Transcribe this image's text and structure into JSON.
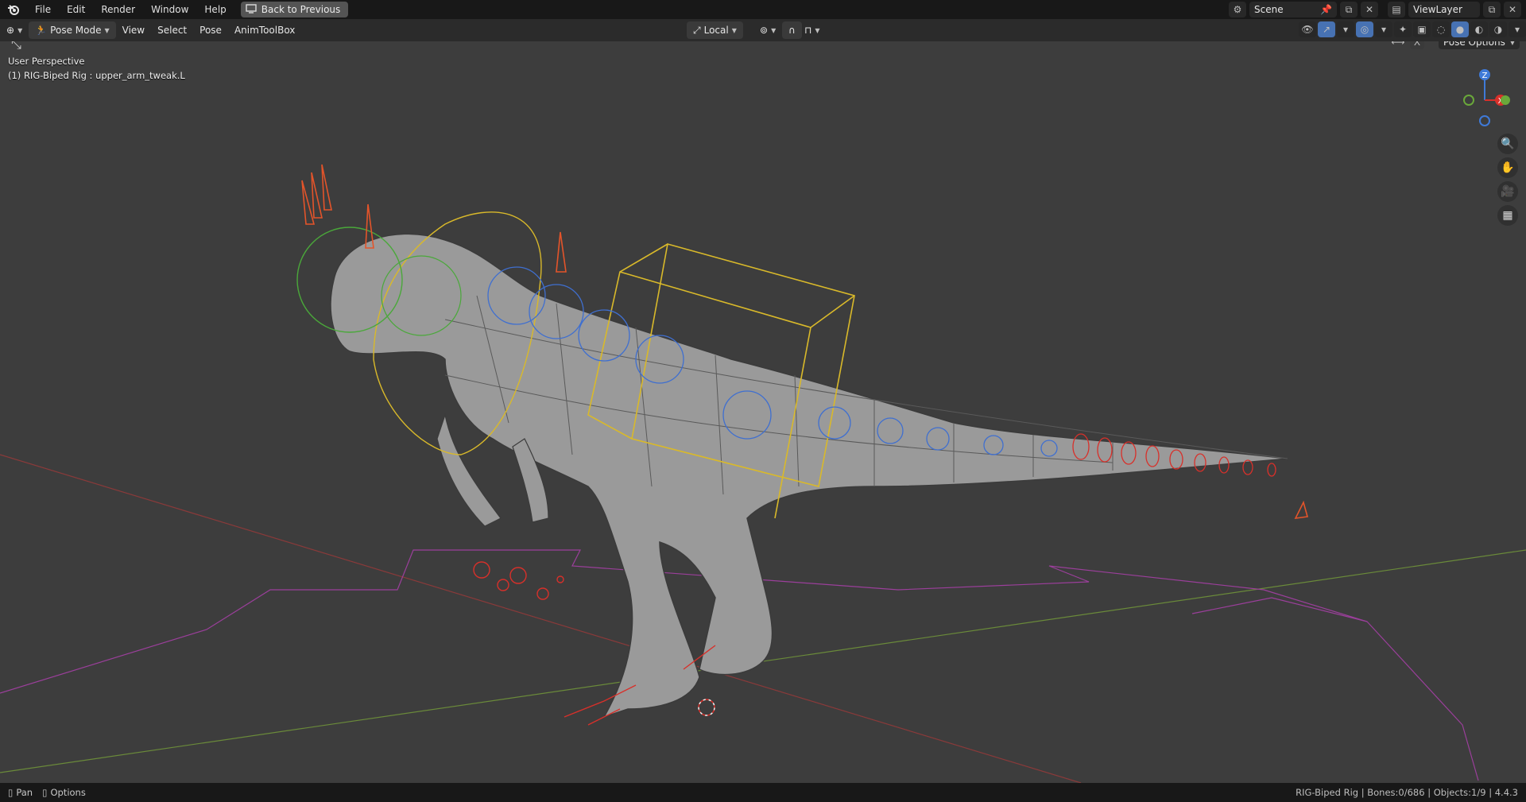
{
  "menubar": {
    "items": [
      "File",
      "Edit",
      "Render",
      "Window",
      "Help"
    ],
    "back_button": "Back to Previous",
    "scene": "Scene",
    "view_layer": "ViewLayer"
  },
  "viewport_header": {
    "mode": "Pose Mode",
    "menus": [
      "View",
      "Select",
      "Pose",
      "AnimToolBox"
    ],
    "transform_orientation": "Local",
    "pose_options": "Pose Options",
    "x_toggle": "X"
  },
  "viewport": {
    "perspective_label": "User Perspective",
    "active_object_label": "(1) RIG-Biped Rig : upper_arm_tweak.L",
    "gizmo_axes": [
      "Z",
      "X"
    ]
  },
  "statusbar": {
    "pan": "Pan",
    "options": "Options",
    "stats": "RIG-Biped Rig | Bones:0/686 | Objects:1/9 | 4.4.3"
  },
  "colors": {
    "viewport_bg": "#3d3d3d",
    "bone_orange": "#e3542a",
    "bone_yellow": "#d9b92a",
    "bone_blue": "#3f6fd0",
    "bone_green": "#4aa83a",
    "bone_red": "#d8302a"
  }
}
